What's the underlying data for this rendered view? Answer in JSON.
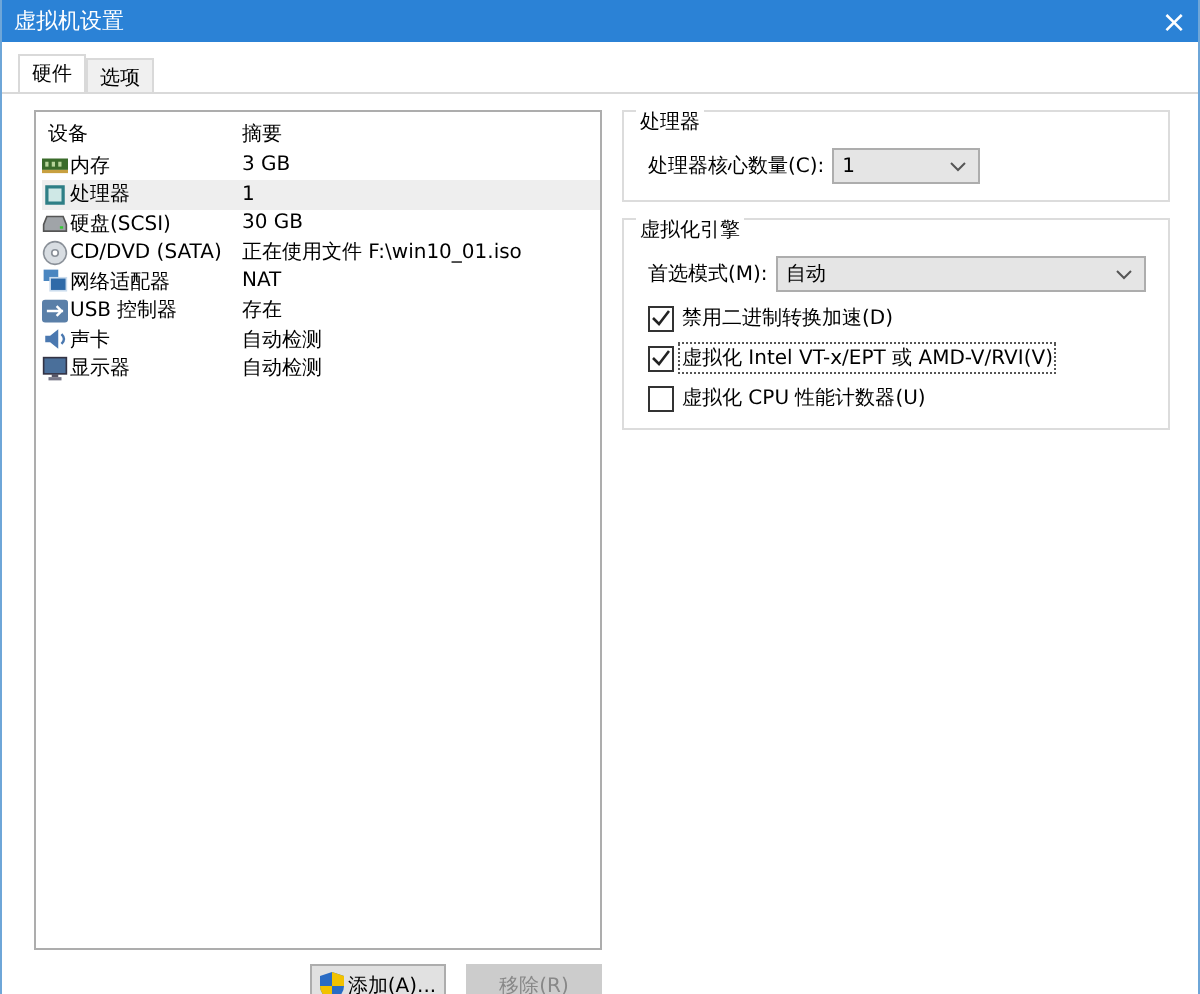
{
  "window": {
    "title": "虚拟机设置",
    "close": "×"
  },
  "tabs": [
    {
      "label": "硬件",
      "selected": true
    },
    {
      "label": "选项",
      "selected": false
    }
  ],
  "devices": {
    "columns": [
      "设备",
      "摘要"
    ],
    "rows": [
      {
        "kind": "memory",
        "name": "内存",
        "summary": "3 GB",
        "selected": false
      },
      {
        "kind": "cpu",
        "name": "处理器",
        "summary": "1",
        "selected": true
      },
      {
        "kind": "disk",
        "name": "硬盘(SCSI)",
        "summary": "30 GB",
        "selected": false
      },
      {
        "kind": "cd",
        "name": "CD/DVD (SATA)",
        "summary": "正在使用文件 F:\\win10_01.iso",
        "selected": false
      },
      {
        "kind": "network",
        "name": "网络适配器",
        "summary": "NAT",
        "selected": false
      },
      {
        "kind": "usb",
        "name": "USB 控制器",
        "summary": "存在",
        "selected": false
      },
      {
        "kind": "sound",
        "name": "声卡",
        "summary": "自动检测",
        "selected": false
      },
      {
        "kind": "display",
        "name": "显示器",
        "summary": "自动检测",
        "selected": false
      }
    ]
  },
  "buttons": [
    {
      "label": "添加(A)...",
      "shield": true,
      "disabled": false
    },
    {
      "label": "移除(R)",
      "shield": false,
      "disabled": true
    }
  ],
  "groups": [
    {
      "title": "处理器",
      "items": [
        {
          "kind": "select",
          "label": "处理器核心数量(C):",
          "value": "1",
          "wide": false
        }
      ]
    },
    {
      "title": "虚拟化引擎",
      "items": [
        {
          "kind": "select",
          "label": "首选模式(M):",
          "value": "自动",
          "wide": true
        },
        {
          "kind": "checkbox",
          "label": "禁用二进制转换加速(D)",
          "checked": true,
          "focused": false
        },
        {
          "kind": "checkbox",
          "label": "虚拟化 Intel VT-x/EPT 或 AMD-V/RVI(V)",
          "checked": true,
          "focused": true
        },
        {
          "kind": "checkbox",
          "label": "虚拟化 CPU 性能计数器(U)",
          "checked": false,
          "focused": false
        }
      ]
    }
  ]
}
